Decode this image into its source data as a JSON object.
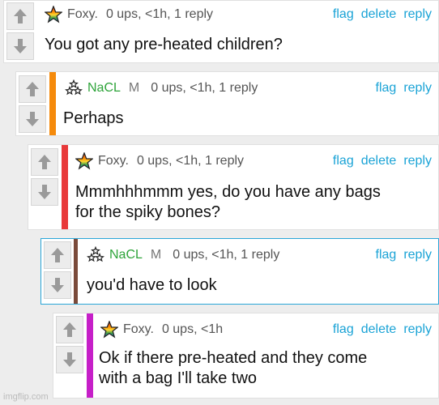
{
  "colors": {
    "link": "#1aa3d6",
    "green_user": "#2ea43a",
    "bar_nacl": "#f58a0b",
    "bar_foxy": "#e8393a",
    "bar_reply3": "#7a4a3a",
    "bar_reply4": "#c61fc8"
  },
  "icons": {
    "upvote": "up-arrow-icon",
    "downvote": "down-arrow-icon",
    "foxy_avatar": "rainbow-star-icon",
    "nacl_avatar": "molecule-stars-icon"
  },
  "comments": [
    {
      "user": "Foxy.",
      "meta": "0 ups, <1h, 1 reply",
      "actions": [
        "flag",
        "delete",
        "reply"
      ],
      "text": "You got any pre-heated children?"
    },
    {
      "user": "NaCL",
      "mod": "M",
      "meta": "0 ups, <1h, 1 reply",
      "actions": [
        "flag",
        "reply"
      ],
      "text": "Perhaps"
    },
    {
      "user": "Foxy.",
      "meta": "0 ups, <1h, 1 reply",
      "actions": [
        "flag",
        "delete",
        "reply"
      ],
      "text_line1": "Mmmhhhmmm yes, do you have any bags",
      "text_line2": "for the spiky bones?"
    },
    {
      "user": "NaCL",
      "mod": "M",
      "meta": "0 ups, <1h, 1 reply",
      "actions": [
        "flag",
        "reply"
      ],
      "text": "you'd have to look"
    },
    {
      "user": "Foxy.",
      "meta": "0 ups, <1h",
      "actions": [
        "flag",
        "delete",
        "reply"
      ],
      "text_line1": "Ok if there pre-heated and they come",
      "text_line2": "with a bag I'll take two"
    }
  ],
  "watermark": "imgflip.com"
}
